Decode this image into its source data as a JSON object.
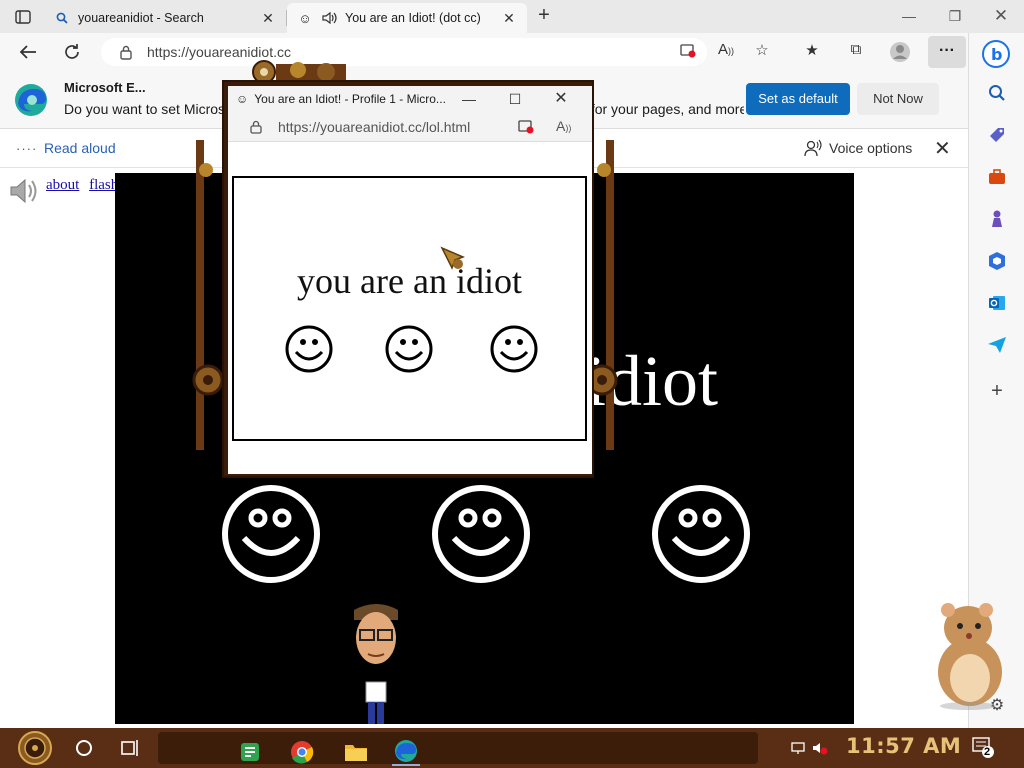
{
  "browser": {
    "tabs": [
      {
        "title": "youareanidiot - Search",
        "icon": "search-icon",
        "active": false
      },
      {
        "title": "You are an Idiot! (dot cc)",
        "icon": "smiley-icon",
        "active": true
      }
    ],
    "address_url": "https://youareanidiot.cc"
  },
  "infobar": {
    "title": "Microsoft E...",
    "message": "Do you want to set Microsoft Edge as your default browser? Get the best experience for your pages, and more?",
    "primary_label": "Set as default",
    "secondary_label": "Not Now"
  },
  "readbar": {
    "read_aloud": "Read aloud",
    "voice_options": "Voice options"
  },
  "page": {
    "links": [
      "about",
      "flash"
    ],
    "big_text": "idiot"
  },
  "popup": {
    "title": "You are an Idiot! - Profile 1 - Micro...",
    "url": "https://youareanidiot.cc/lol.html",
    "phrase": "you are an idiot"
  },
  "taskbar": {
    "clock": "11:57 AM",
    "notification_count": "2"
  },
  "colors": {
    "edge_blue": "#0f6cbd",
    "taskbar_brown": "#5a2e14",
    "clock_gold": "#e9c27a"
  }
}
